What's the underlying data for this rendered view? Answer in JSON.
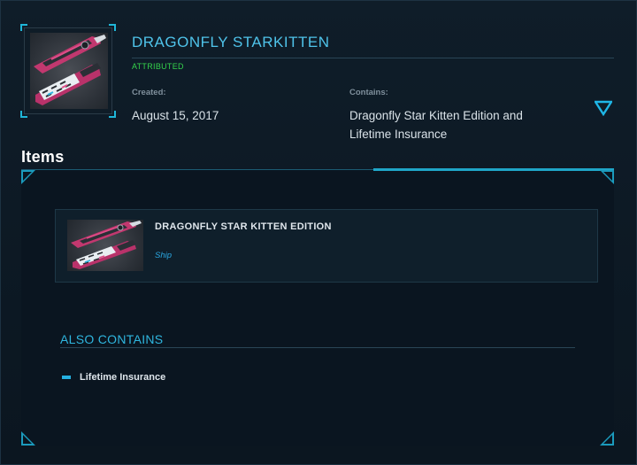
{
  "pledge": {
    "title": "DRAGONFLY STARKITTEN",
    "status": "ATTRIBUTED",
    "created_label": "Created:",
    "created_value": "August 15, 2017",
    "contains_label": "Contains:",
    "contains_value": "Dragonfly Star Kitten Edition and Lifetime Insurance",
    "thumbnail_icon": "ship-image",
    "expand_icon": "chevron-down-icon"
  },
  "items_section": {
    "heading": "Items",
    "items": [
      {
        "name": "DRAGONFLY STAR KITTEN EDITION",
        "kind": "Ship",
        "thumbnail_icon": "ship-image"
      }
    ]
  },
  "also_contains": {
    "heading": "ALSO CONTAINS",
    "entries": [
      "Lifetime Insurance"
    ]
  },
  "colors": {
    "accent": "#1fb6d8",
    "title": "#4fc3ea",
    "status": "#34d34c",
    "item_kind": "#2aa6e0",
    "background": "#0d1822"
  }
}
